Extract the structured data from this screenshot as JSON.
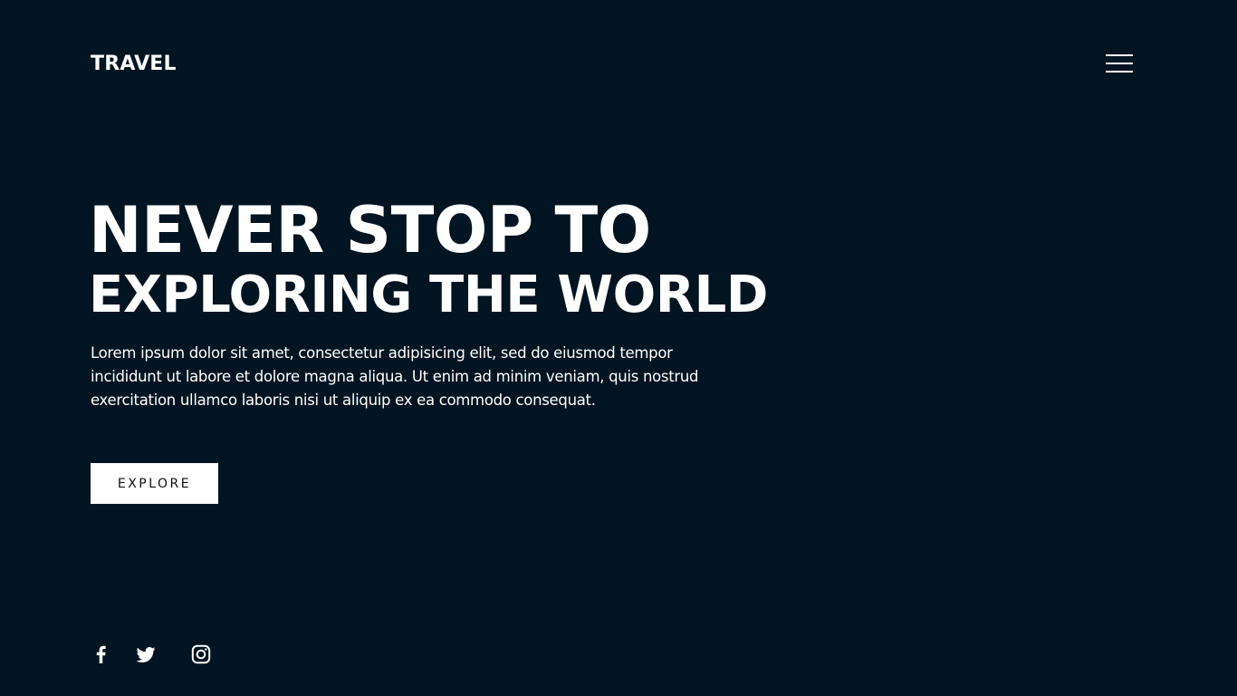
{
  "header": {
    "logo": "TRAVEL",
    "menu_icon": "hamburger-menu-icon"
  },
  "hero": {
    "title_line1": "NEVER STOP TO",
    "title_line2": "EXPLORING THE WORLD",
    "description": "Lorem ipsum dolor sit amet, consectetur adipisicing elit, sed do eiusmod tempor incididunt ut labore et dolore magna aliqua. Ut enim ad minim veniam, quis nostrud exercitation ullamco laboris nisi ut aliquip ex ea commodo consequat.",
    "cta_label": "EXPLORE"
  },
  "social": [
    {
      "icon": "facebook-icon"
    },
    {
      "icon": "twitter-icon"
    },
    {
      "icon": "instagram-icon"
    }
  ],
  "colors": {
    "background": "#011421",
    "text": "#ffffff",
    "button_bg": "#ffffff",
    "button_text": "#111111"
  }
}
